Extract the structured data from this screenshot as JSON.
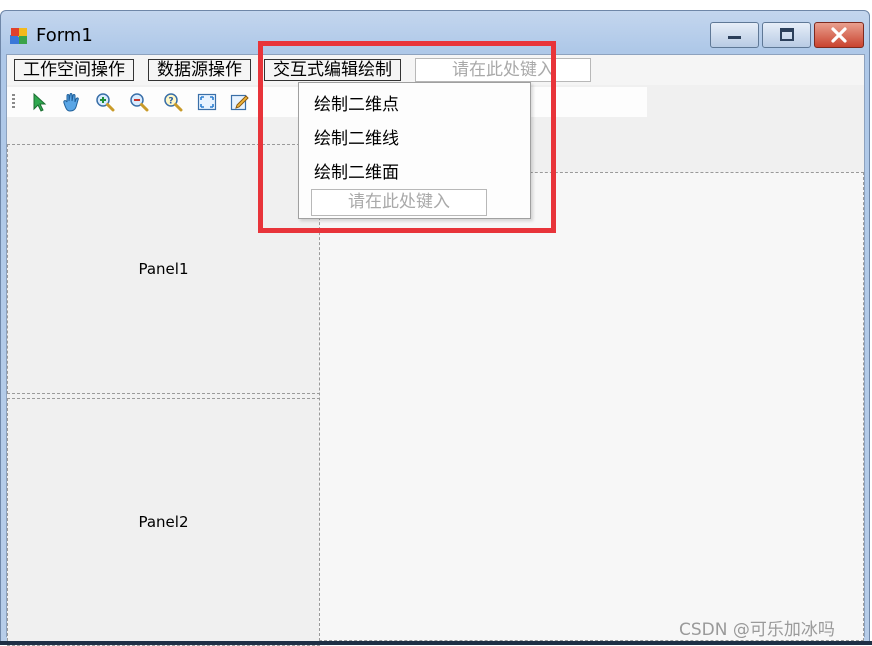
{
  "window": {
    "title": "Form1",
    "controls": {
      "minimize": "minimize",
      "maximize": "maximize",
      "close": "close"
    }
  },
  "menubar": {
    "items": [
      {
        "label": "工作空间操作"
      },
      {
        "label": "数据源操作"
      },
      {
        "label": "交互式编辑绘制"
      }
    ],
    "new_item_placeholder": "请在此处键入"
  },
  "toolbar": {
    "tools": [
      {
        "icon": "select-arrow-icon"
      },
      {
        "icon": "pan-hand-icon"
      },
      {
        "icon": "zoom-in-icon"
      },
      {
        "icon": "zoom-out-icon"
      },
      {
        "icon": "query-icon"
      },
      {
        "icon": "full-extent-icon"
      },
      {
        "icon": "edit-icon"
      }
    ]
  },
  "panels": {
    "panel1": "Panel1",
    "panel2": "Panel2"
  },
  "dropdown": {
    "items": [
      {
        "label": "绘制二维点"
      },
      {
        "label": "绘制二维线"
      },
      {
        "label": "绘制二维面"
      }
    ],
    "new_item_placeholder": "请在此处键入"
  },
  "watermark": "CSDN @可乐加冰吗",
  "colors": {
    "highlight_box": "#e8343a",
    "title_gradient": "#aec8e8",
    "close_button": "#c9432f"
  }
}
